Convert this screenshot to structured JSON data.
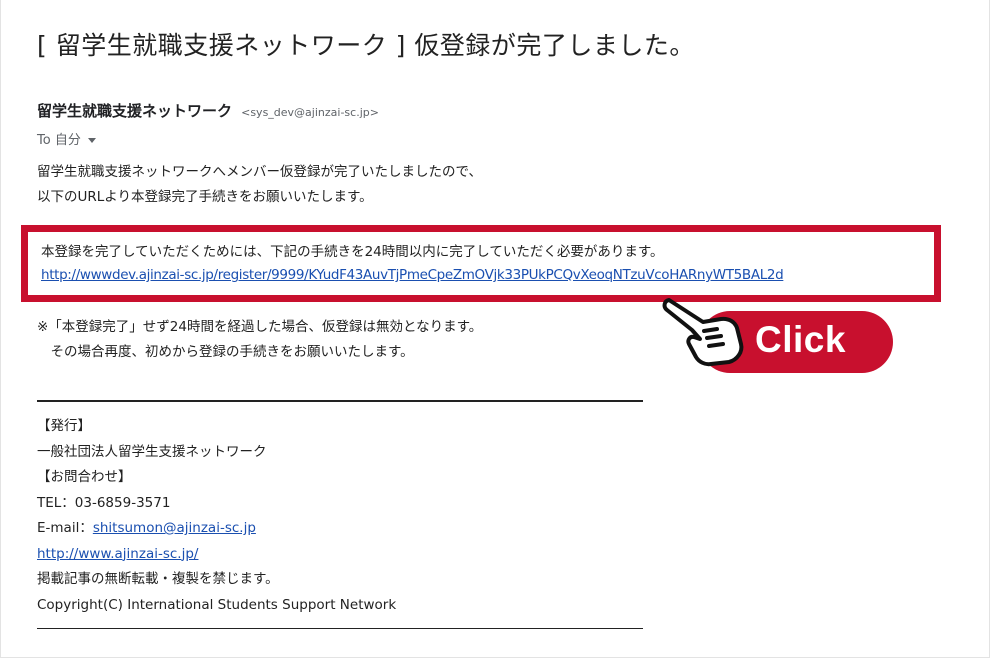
{
  "email": {
    "subject": "[ 留学生就職支援ネットワーク ] 仮登録が完了しました。",
    "sender_name": "留学生就職支援ネットワーク",
    "sender_email": "<sys_dev@ajinzai-sc.jp>",
    "to_label": "To 自分",
    "intro_lines": [
      "留学生就職支援ネットワークへメンバー仮登録が完了いたしましたので、",
      "以下のURLより本登録完了手続きをお願いいたします。"
    ],
    "notice": "本登録を完了していただくためには、下記の手続きを24時間以内に完了していただく必要があります。",
    "registration_link": "http://wwwdev.ajinzai-sc.jp/register/9999/KYudF43AuvTjPmeCpeZmOVjk33PUkPCQvXeoqNTzuVcoHARnyWT5BAL2d",
    "warning_lines": [
      "※「本登録完了」せず24時間を経過した場合、仮登録は無効となります。",
      "　その場合再度、初めから登録の手続きをお願いいたします。"
    ],
    "footer": {
      "publisher_heading": "【発行】",
      "publisher_name": "一般社団法人留学生支援ネットワーク",
      "contact_heading": "【お問合わせ】",
      "tel": "TEL：03-6859-3571",
      "email_label": "E-mail：",
      "email_link": "shitsumon@ajinzai-sc.jp",
      "website": "http://www.ajinzai-sc.jp/",
      "notice": "掲載記事の無断転載・複製を禁じます。",
      "copyright": "Copyright(C) International Students Support Network"
    }
  },
  "callout": {
    "label": "Click",
    "icon": "pointing-hand-icon",
    "accent_color": "#c8102e"
  }
}
